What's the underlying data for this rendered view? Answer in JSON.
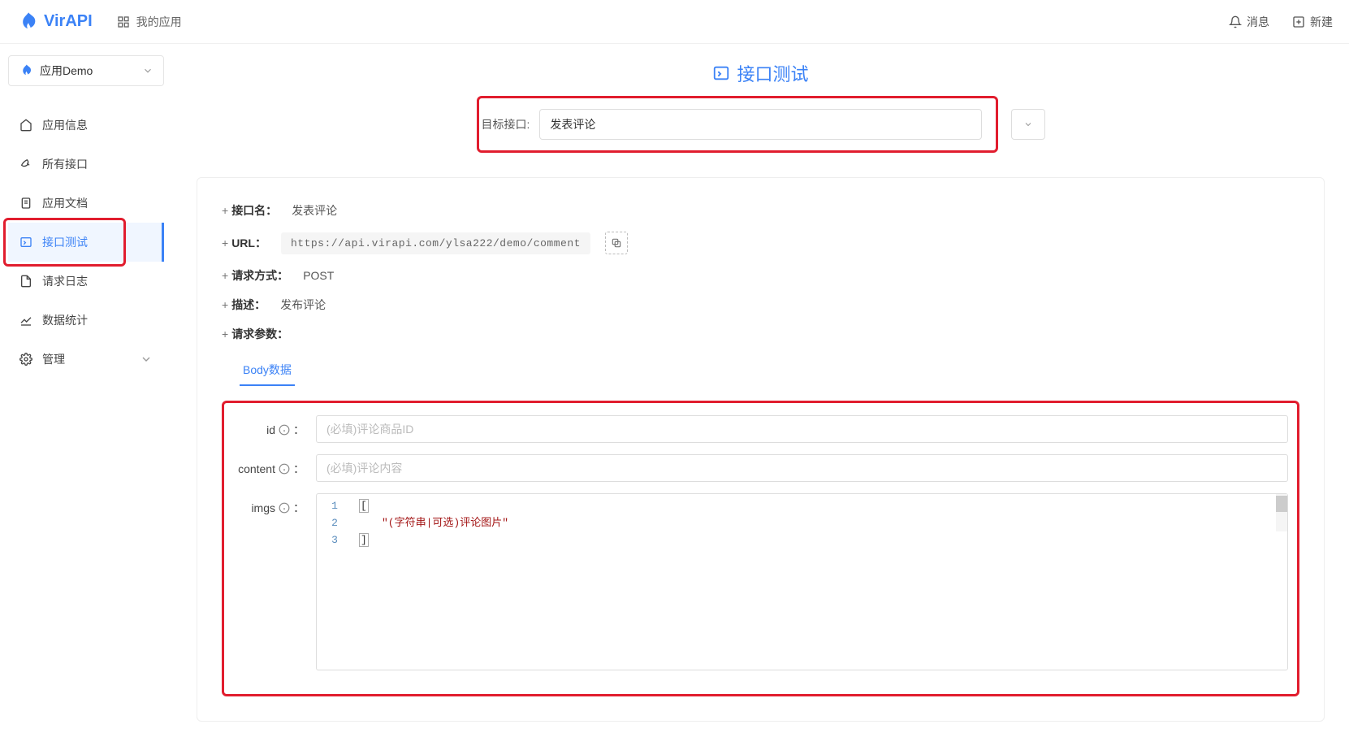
{
  "header": {
    "brand": "VirAPI",
    "nav_my_apps": "我的应用",
    "messages": "消息",
    "create_new": "新建"
  },
  "sidebar": {
    "app_selector": "应用Demo",
    "items": [
      {
        "label": "应用信息",
        "icon": "home"
      },
      {
        "label": "所有接口",
        "icon": "rocket"
      },
      {
        "label": "应用文档",
        "icon": "doc"
      },
      {
        "label": "接口测试",
        "icon": "terminal",
        "active": true
      },
      {
        "label": "请求日志",
        "icon": "file"
      },
      {
        "label": "数据统计",
        "icon": "chart"
      },
      {
        "label": "管理",
        "icon": "gear",
        "expandable": true
      }
    ]
  },
  "page": {
    "title": "接口测试",
    "target_label": "目标接口:",
    "target_value": "发表评论"
  },
  "api": {
    "name_label": "接口名：",
    "name_value": "发表评论",
    "url_label": "URL：",
    "url_value": "https://api.virapi.com/ylsa222/demo/comment",
    "method_label": "请求方式：",
    "method_value": "POST",
    "desc_label": "描述：",
    "desc_value": "发布评论",
    "params_label": "请求参数：",
    "tab_body": "Body数据"
  },
  "form": {
    "fields": {
      "id": {
        "label": "id",
        "placeholder": "(必填)评论商品ID"
      },
      "content": {
        "label": "content",
        "placeholder": "(必填)评论内容"
      },
      "imgs": {
        "label": "imgs",
        "code": {
          "lines": [
            "1",
            "2",
            "3"
          ],
          "open": "[",
          "string": "\"(字符串|可选)评论图片\"",
          "close": "]"
        }
      }
    },
    "colon": "："
  }
}
